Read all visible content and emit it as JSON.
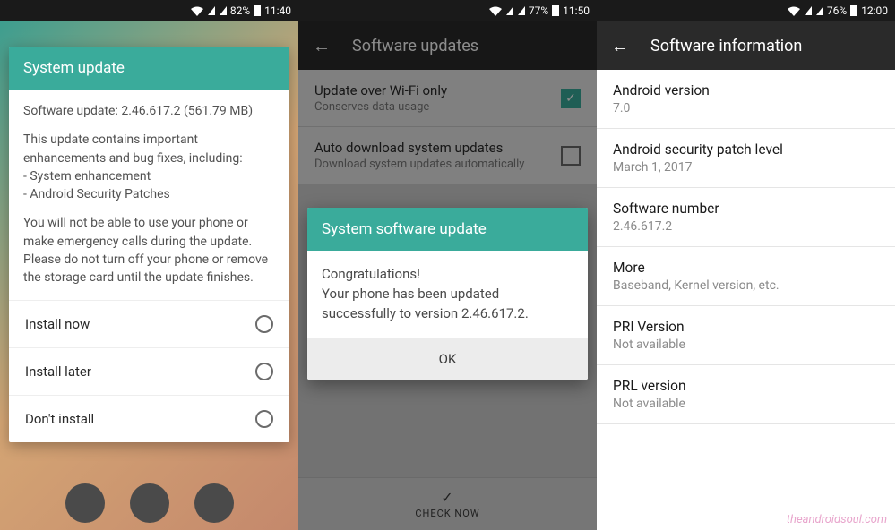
{
  "watermark": "theandroidsoul.com",
  "phone1": {
    "status": {
      "battery_pct": "82%",
      "time": "11:40"
    },
    "dialog": {
      "title": "System update",
      "version_line": "Software update: 2.46.617.2 (561.79 MB)",
      "desc1": "This update contains important enhancements and bug fixes, including:",
      "desc1_b1": "- System enhancement",
      "desc1_b2": "- Android Security Patches",
      "desc2": "You will not be able to use your phone or make emergency calls during the update. Please do not turn off your phone or remove the storage card until the update finishes.",
      "opt1": "Install now",
      "opt2": "Install later",
      "opt3": "Don't install"
    }
  },
  "phone2": {
    "status": {
      "battery_pct": "77%",
      "time": "11:50"
    },
    "appbar_title": "Software updates",
    "row1": {
      "title": "Update over Wi-Fi only",
      "desc": "Conserves data usage"
    },
    "row2": {
      "title": "Auto download system updates",
      "desc": "Download system updates automatically"
    },
    "dialog": {
      "title": "System software update",
      "line1": "Congratulations!",
      "line2": "Your phone has been updated successfully to version 2.46.617.2.",
      "ok": "OK"
    },
    "check_now": "CHECK NOW"
  },
  "phone3": {
    "status": {
      "battery_pct": "76%",
      "time": "12:00"
    },
    "appbar_title": "Software information",
    "rows": [
      {
        "title": "Android version",
        "desc": "7.0"
      },
      {
        "title": "Android security patch level",
        "desc": "March 1, 2017"
      },
      {
        "title": "Software number",
        "desc": "2.46.617.2"
      },
      {
        "title": "More",
        "desc": "Baseband, Kernel version, etc."
      },
      {
        "title": "PRI Version",
        "desc": "Not available"
      },
      {
        "title": "PRL version",
        "desc": "Not available"
      }
    ]
  }
}
